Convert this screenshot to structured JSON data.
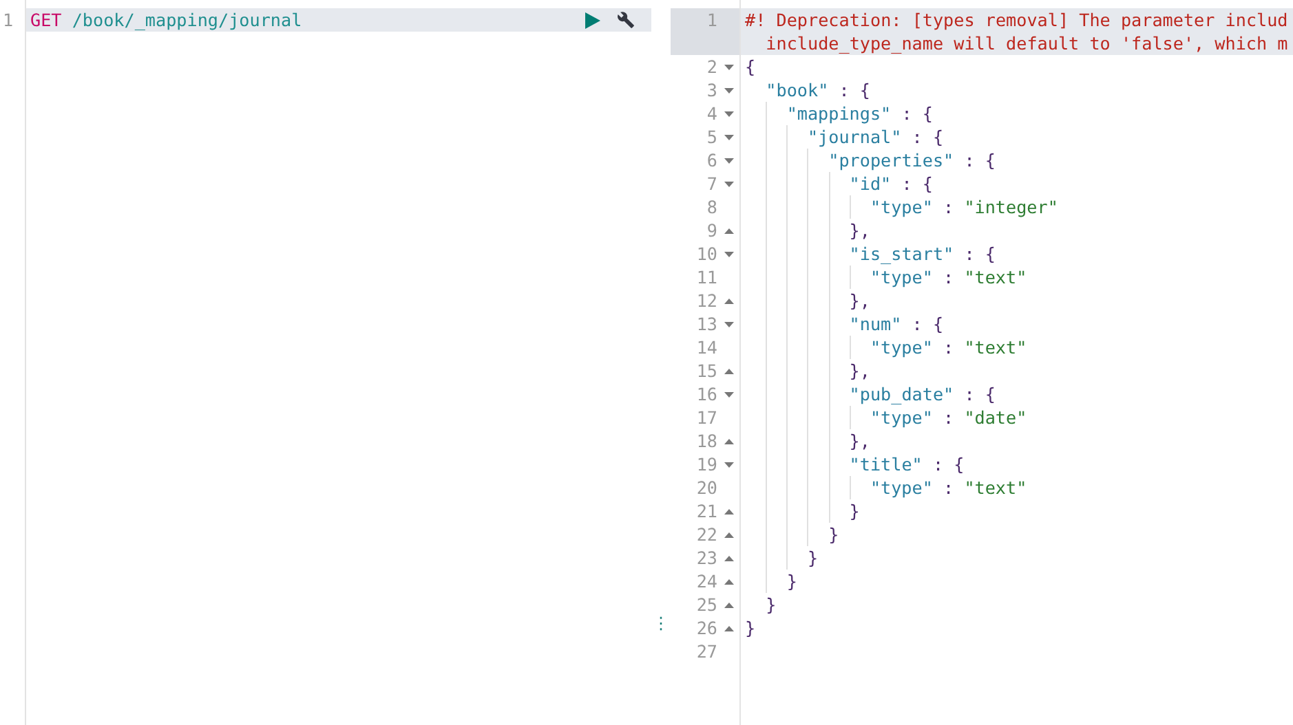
{
  "request": {
    "line_number": "1",
    "method": "GET",
    "path": "/book/_mapping/journal",
    "highlighted": true
  },
  "divider": {
    "handle": "⋮"
  },
  "response": {
    "lines": [
      {
        "number": "1",
        "text": "#! Deprecation: [types removal] The parameter includ",
        "wrap": "include_type_name will default to 'false', which m",
        "kind": "comment",
        "active": true
      },
      {
        "number": "2",
        "text": "{",
        "kind": "fold-start",
        "active": false
      },
      {
        "number": "3",
        "text": "  \"book\" : {",
        "kind": "fold-start",
        "active": false
      },
      {
        "number": "4",
        "text": "    \"mappings\" : {",
        "kind": "fold-start",
        "active": false
      },
      {
        "number": "5",
        "text": "      \"journal\" : {",
        "kind": "fold-start",
        "active": false
      },
      {
        "number": "6",
        "text": "        \"properties\" : {",
        "kind": "fold-start",
        "active": false
      },
      {
        "number": "7",
        "text": "          \"id\" : {",
        "kind": "fold-start",
        "active": false
      },
      {
        "number": "8",
        "text": "            \"type\" : \"integer\"",
        "kind": "plain",
        "active": false
      },
      {
        "number": "9",
        "text": "          },",
        "kind": "fold-end",
        "active": false
      },
      {
        "number": "10",
        "text": "          \"is_start\" : {",
        "kind": "fold-start",
        "active": false
      },
      {
        "number": "11",
        "text": "            \"type\" : \"text\"",
        "kind": "plain",
        "active": false
      },
      {
        "number": "12",
        "text": "          },",
        "kind": "fold-end",
        "active": false
      },
      {
        "number": "13",
        "text": "          \"num\" : {",
        "kind": "fold-start",
        "active": false
      },
      {
        "number": "14",
        "text": "            \"type\" : \"text\"",
        "kind": "plain",
        "active": false
      },
      {
        "number": "15",
        "text": "          },",
        "kind": "fold-end",
        "active": false
      },
      {
        "number": "16",
        "text": "          \"pub_date\" : {",
        "kind": "fold-start",
        "active": false
      },
      {
        "number": "17",
        "text": "            \"type\" : \"date\"",
        "kind": "plain",
        "active": false
      },
      {
        "number": "18",
        "text": "          },",
        "kind": "fold-end",
        "active": false
      },
      {
        "number": "19",
        "text": "          \"title\" : {",
        "kind": "fold-start",
        "active": false
      },
      {
        "number": "20",
        "text": "            \"type\" : \"text\"",
        "kind": "plain",
        "active": false
      },
      {
        "number": "21",
        "text": "          }",
        "kind": "fold-end",
        "active": false
      },
      {
        "number": "22",
        "text": "        }",
        "kind": "fold-end",
        "active": false
      },
      {
        "number": "23",
        "text": "      }",
        "kind": "fold-end",
        "active": false
      },
      {
        "number": "24",
        "text": "    }",
        "kind": "fold-end",
        "active": false
      },
      {
        "number": "25",
        "text": "  }",
        "kind": "fold-end",
        "active": false
      },
      {
        "number": "26",
        "text": "}",
        "kind": "fold-end",
        "active": false
      },
      {
        "number": "27",
        "kind": "plain",
        "active": false
      }
    ]
  }
}
